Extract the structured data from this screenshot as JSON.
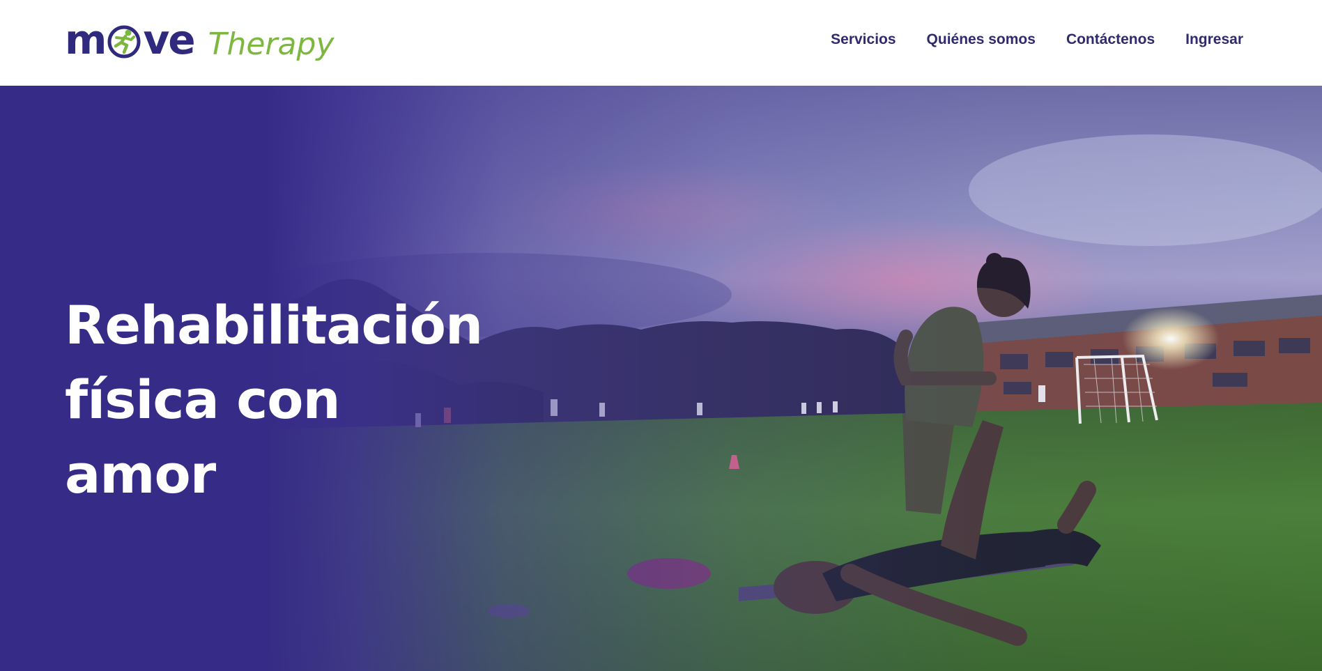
{
  "brand": {
    "logo_word_before_icon": "m",
    "logo_word_after_icon": "ve",
    "logo_tagline": "Therapy",
    "primary_color": "#2f2a7e",
    "accent_color": "#7db73f"
  },
  "nav": {
    "items": [
      {
        "label": "Servicios"
      },
      {
        "label": "Quiénes somos"
      },
      {
        "label": "Contáctenos"
      },
      {
        "label": "Ingresar"
      }
    ]
  },
  "hero": {
    "title": "Rehabilitación física con amor",
    "overlay_color": "#362b86"
  }
}
